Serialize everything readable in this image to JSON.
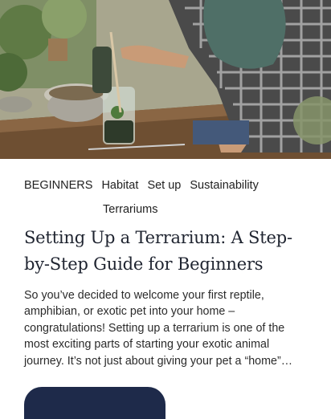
{
  "hero": {
    "icon": "terrarium-photo-image"
  },
  "tags": {
    "row1": [
      "BEGINNERS",
      "Habitat",
      "Set up",
      "Sustainability"
    ],
    "row2": "Terrariums"
  },
  "article": {
    "title": "Setting Up a Terrarium: A Step-by-Step Guide for Beginners",
    "excerpt": "So you’ve decided to welcome your first reptile, amphibian, or exotic pet into your home – congratulations! Setting up a terrarium is one of the most exciting parts of starting your exotic animal journey. It’s not just about giving your pet a “home”…"
  },
  "colors": {
    "button": "#1e2a4a"
  }
}
